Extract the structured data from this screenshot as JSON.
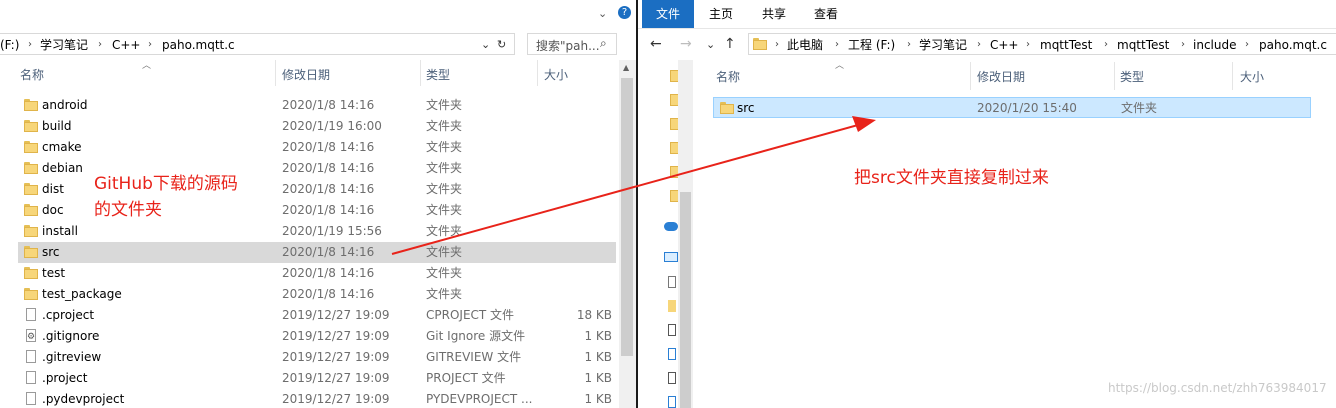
{
  "left_pane": {
    "help_icon": "?",
    "address": {
      "crumbs": [
        "(F:)",
        "学习笔记",
        "C++",
        "paho.mqtt.c"
      ],
      "dropdown_icon": "chevron-down-icon",
      "refresh_icon": "refresh-icon"
    },
    "search": {
      "placeholder": "搜索\"pah...",
      "icon": "search-icon"
    },
    "columns": {
      "name": "名称",
      "date": "修改日期",
      "type": "类型",
      "size": "大小"
    },
    "files": [
      {
        "name": "android",
        "date": "2020/1/8 14:16",
        "type": "文件夹",
        "size": "",
        "icon": "folder-icon"
      },
      {
        "name": "build",
        "date": "2020/1/19 16:00",
        "type": "文件夹",
        "size": "",
        "icon": "folder-icon"
      },
      {
        "name": "cmake",
        "date": "2020/1/8 14:16",
        "type": "文件夹",
        "size": "",
        "icon": "folder-icon"
      },
      {
        "name": "debian",
        "date": "2020/1/8 14:16",
        "type": "文件夹",
        "size": "",
        "icon": "folder-icon"
      },
      {
        "name": "dist",
        "date": "2020/1/8 14:16",
        "type": "文件夹",
        "size": "",
        "icon": "folder-icon"
      },
      {
        "name": "doc",
        "date": "2020/1/8 14:16",
        "type": "文件夹",
        "size": "",
        "icon": "folder-icon"
      },
      {
        "name": "install",
        "date": "2020/1/19 15:56",
        "type": "文件夹",
        "size": "",
        "icon": "folder-icon"
      },
      {
        "name": "src",
        "date": "2020/1/8 14:16",
        "type": "文件夹",
        "size": "",
        "icon": "folder-icon"
      },
      {
        "name": "test",
        "date": "2020/1/8 14:16",
        "type": "文件夹",
        "size": "",
        "icon": "folder-icon"
      },
      {
        "name": "test_package",
        "date": "2020/1/8 14:16",
        "type": "文件夹",
        "size": "",
        "icon": "folder-icon"
      },
      {
        "name": ".cproject",
        "date": "2019/12/27 19:09",
        "type": "CPROJECT 文件",
        "size": "18 KB",
        "icon": "file-icon"
      },
      {
        "name": ".gitignore",
        "date": "2019/12/27 19:09",
        "type": "Git Ignore 源文件",
        "size": "1 KB",
        "icon": "config-file-icon"
      },
      {
        "name": ".gitreview",
        "date": "2019/12/27 19:09",
        "type": "GITREVIEW 文件",
        "size": "1 KB",
        "icon": "file-icon"
      },
      {
        "name": ".project",
        "date": "2019/12/27 19:09",
        "type": "PROJECT 文件",
        "size": "1 KB",
        "icon": "file-icon"
      },
      {
        "name": ".pydevproject",
        "date": "2019/12/27 19:09",
        "type": "PYDEVPROJECT ...",
        "size": "1 KB",
        "icon": "file-icon"
      }
    ],
    "annotation_line1": "GitHub下载的源码",
    "annotation_line2": "的文件夹"
  },
  "right_pane": {
    "ribbon_tabs": [
      "文件",
      "主页",
      "共享",
      "查看"
    ],
    "address": {
      "crumbs": [
        "此电脑",
        "工程 (F:)",
        "学习笔记",
        "C++",
        "mqttTest",
        "mqttTest",
        "include",
        "paho.mqt.c"
      ]
    },
    "columns": {
      "name": "名称",
      "date": "修改日期",
      "type": "类型",
      "size": "大小"
    },
    "files": [
      {
        "name": "src",
        "date": "2020/1/20 15:40",
        "type": "文件夹",
        "size": "",
        "icon": "folder-icon"
      }
    ],
    "annotation": "把src文件夹直接复制过来"
  },
  "colors": {
    "annotation": "#e8231a",
    "ribbon_active": "#1b6ec2",
    "selection_blue": "#cce8ff"
  },
  "watermark": "https://blog.csdn.net/zhh763984017"
}
